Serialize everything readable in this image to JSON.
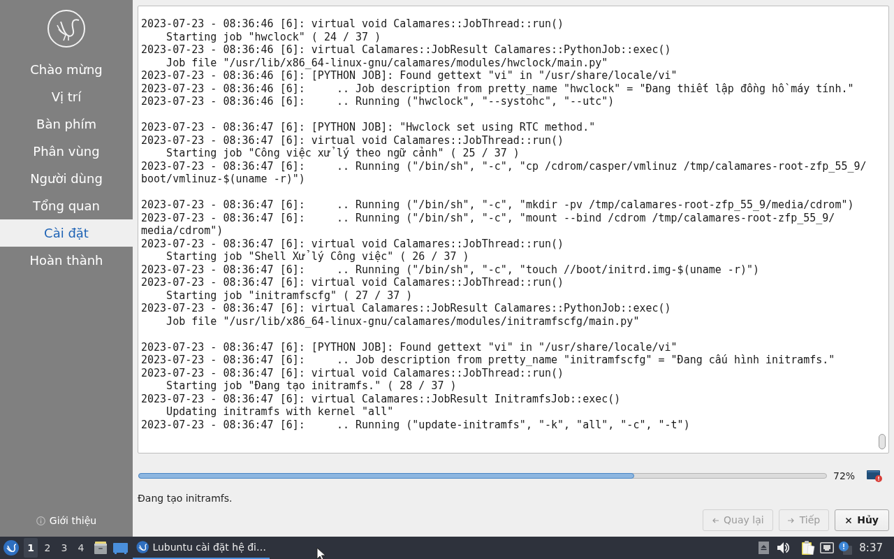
{
  "sidebar": {
    "items": [
      {
        "label": "Chào mừng",
        "selected": false
      },
      {
        "label": "Vị trí",
        "selected": false
      },
      {
        "label": "Bàn phím",
        "selected": false
      },
      {
        "label": "Phân vùng",
        "selected": false
      },
      {
        "label": "Người dùng",
        "selected": false
      },
      {
        "label": "Tổng quan",
        "selected": false
      },
      {
        "label": "Cài đặt",
        "selected": true
      },
      {
        "label": "Hoàn thành",
        "selected": false
      }
    ],
    "about": {
      "label": "Giới thiệu"
    }
  },
  "log": {
    "blocks": [
      {
        "lines": [
          "2023-07-23 - 08:36:46 [6]: virtual void Calamares::JobThread::run()",
          "    Starting job \"hwclock\" ( 24 / 37 )",
          "2023-07-23 - 08:36:46 [6]: virtual Calamares::JobResult Calamares::PythonJob::exec()",
          "    Job file \"/usr/lib/x86_64-linux-gnu/calamares/modules/hwclock/main.py\"",
          "2023-07-23 - 08:36:46 [6]: [PYTHON JOB]: Found gettext \"vi\" in \"/usr/share/locale/vi\"",
          "2023-07-23 - 08:36:46 [6]:     .. Job description from pretty_name \"hwclock\" = \"Đang thiết lập đồng hồ máy tính.\"",
          "2023-07-23 - 08:36:46 [6]:     .. Running (\"hwclock\", \"--systohc\", \"--utc\")"
        ]
      },
      {
        "lines": [
          "2023-07-23 - 08:36:47 [6]: [PYTHON JOB]: \"Hwclock set using RTC method.\"",
          "2023-07-23 - 08:36:47 [6]: virtual void Calamares::JobThread::run()",
          "    Starting job \"Công việc xử lý theo ngữ cảnh\" ( 25 / 37 )",
          "2023-07-23 - 08:36:47 [6]:     .. Running (\"/bin/sh\", \"-c\", \"cp /cdrom/casper/vmlinuz /tmp/calamares-root-zfp_55_9/",
          "boot/vmlinuz-$(uname -r)\")"
        ]
      },
      {
        "lines": [
          "2023-07-23 - 08:36:47 [6]:     .. Running (\"/bin/sh\", \"-c\", \"mkdir -pv /tmp/calamares-root-zfp_55_9/media/cdrom\")",
          "2023-07-23 - 08:36:47 [6]:     .. Running (\"/bin/sh\", \"-c\", \"mount --bind /cdrom /tmp/calamares-root-zfp_55_9/",
          "media/cdrom\")",
          "2023-07-23 - 08:36:47 [6]: virtual void Calamares::JobThread::run()",
          "    Starting job \"Shell Xử lý Công việc\" ( 26 / 37 )",
          "2023-07-23 - 08:36:47 [6]:     .. Running (\"/bin/sh\", \"-c\", \"touch //boot/initrd.img-$(uname -r)\")",
          "2023-07-23 - 08:36:47 [6]: virtual void Calamares::JobThread::run()",
          "    Starting job \"initramfscfg\" ( 27 / 37 )",
          "2023-07-23 - 08:36:47 [6]: virtual Calamares::JobResult Calamares::PythonJob::exec()",
          "    Job file \"/usr/lib/x86_64-linux-gnu/calamares/modules/initramfscfg/main.py\""
        ]
      },
      {
        "lines": [
          "2023-07-23 - 08:36:47 [6]: [PYTHON JOB]: Found gettext \"vi\" in \"/usr/share/locale/vi\"",
          "2023-07-23 - 08:36:47 [6]:     .. Job description from pretty_name \"initramfscfg\" = \"Đang cấu hình initramfs.\"",
          "2023-07-23 - 08:36:47 [6]: virtual void Calamares::JobThread::run()",
          "    Starting job \"Đang tạo initramfs.\" ( 28 / 37 )",
          "2023-07-23 - 08:36:47 [6]: virtual Calamares::JobResult InitramfsJob::exec()",
          "    Updating initramfs with kernel \"all\"",
          "2023-07-23 - 08:36:47 [6]:     .. Running (\"update-initramfs\", \"-k\", \"all\", \"-c\", \"-t\")"
        ]
      }
    ]
  },
  "progress": {
    "level": 0.72,
    "reading": "72%"
  },
  "status_text": "Đang tạo initramfs.",
  "buttons": [
    {
      "kind": "back",
      "label": "Quay lại",
      "disabled": true
    },
    {
      "kind": "next",
      "label": "Tiếp",
      "disabled": true
    },
    {
      "kind": "cancel",
      "label": "Hủy",
      "disabled": false
    }
  ],
  "taskbar": {
    "workspaces": [
      {
        "label": "1",
        "selected": true
      },
      {
        "label": "2",
        "selected": false
      },
      {
        "label": "3",
        "selected": false
      },
      {
        "label": "4",
        "selected": false
      }
    ],
    "tasks": [
      {
        "title": "Lubuntu cài đặt hệ đi…",
        "selected": true
      }
    ],
    "clock": "8:37"
  }
}
